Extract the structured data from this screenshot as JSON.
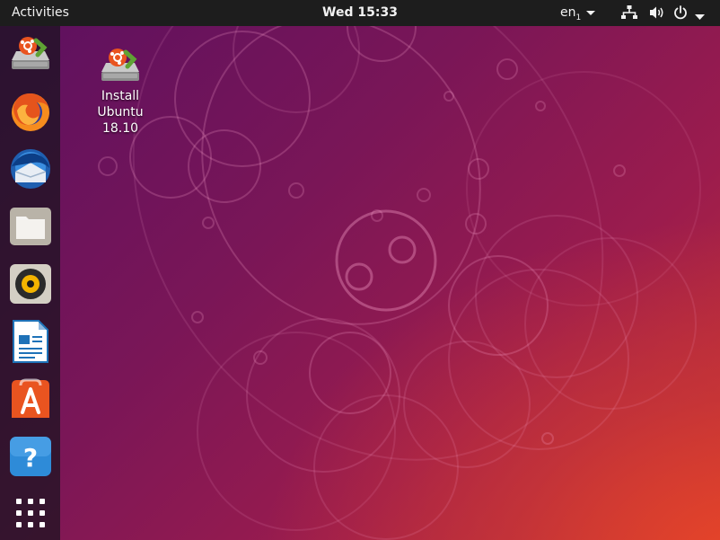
{
  "topbar": {
    "activities_label": "Activities",
    "clock": "Wed 15:33",
    "input_source": "en",
    "input_source_sub": "1"
  },
  "tray": {
    "icons": [
      "network-icon",
      "volume-icon",
      "power-icon",
      "chevron-down-icon"
    ]
  },
  "dock": {
    "items": [
      {
        "name": "install-ubuntu",
        "icon": "installer-icon"
      },
      {
        "name": "firefox",
        "icon": "firefox-icon"
      },
      {
        "name": "thunderbird",
        "icon": "thunderbird-icon"
      },
      {
        "name": "files",
        "icon": "files-icon"
      },
      {
        "name": "rhythmbox",
        "icon": "rhythmbox-icon"
      },
      {
        "name": "libreoffice-writer",
        "icon": "writer-icon"
      },
      {
        "name": "ubuntu-software",
        "icon": "software-icon"
      },
      {
        "name": "help",
        "icon": "help-icon"
      },
      {
        "name": "show-applications",
        "icon": "app-grid-icon"
      }
    ]
  },
  "desktop": {
    "installer": {
      "line1": "Install",
      "line2": "Ubuntu",
      "line3": "18.10"
    }
  },
  "colors": {
    "topbar": "#1d1d1d",
    "wallpaper_dark": "#5b1060",
    "wallpaper_bright": "#c43133",
    "ubuntu_orange": "#e95420"
  }
}
